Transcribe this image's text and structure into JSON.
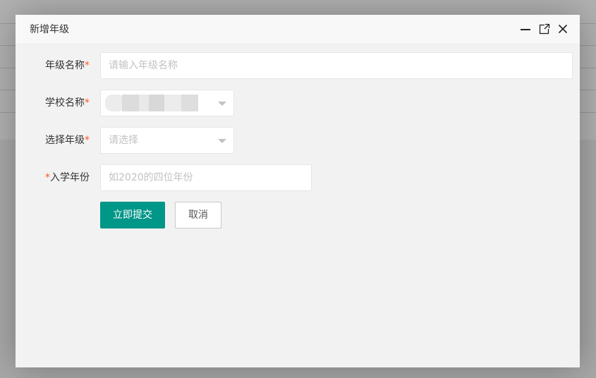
{
  "dialog": {
    "title": "新增年级",
    "controls": {
      "minimize_icon": "minimize-icon",
      "maximize_icon": "maximize-icon",
      "close_icon": "close-icon"
    }
  },
  "form": {
    "grade_name": {
      "label": "年级名称",
      "required_mark": "*",
      "placeholder": "请输入年级名称",
      "value": ""
    },
    "school_name": {
      "label": "学校名称",
      "required_mark": "*",
      "selected_value": "(redacted)"
    },
    "select_grade": {
      "label": "选择年级",
      "required_mark": "*",
      "placeholder": "请选择"
    },
    "entry_year": {
      "label": "入学年份",
      "required_mark": "*",
      "placeholder": "如2020的四位年份",
      "value": ""
    }
  },
  "buttons": {
    "submit": "立即提交",
    "cancel": "取消"
  },
  "colors": {
    "primary": "#009688",
    "required": "#ff5722",
    "overlay_bg": "#f2f2f2"
  }
}
